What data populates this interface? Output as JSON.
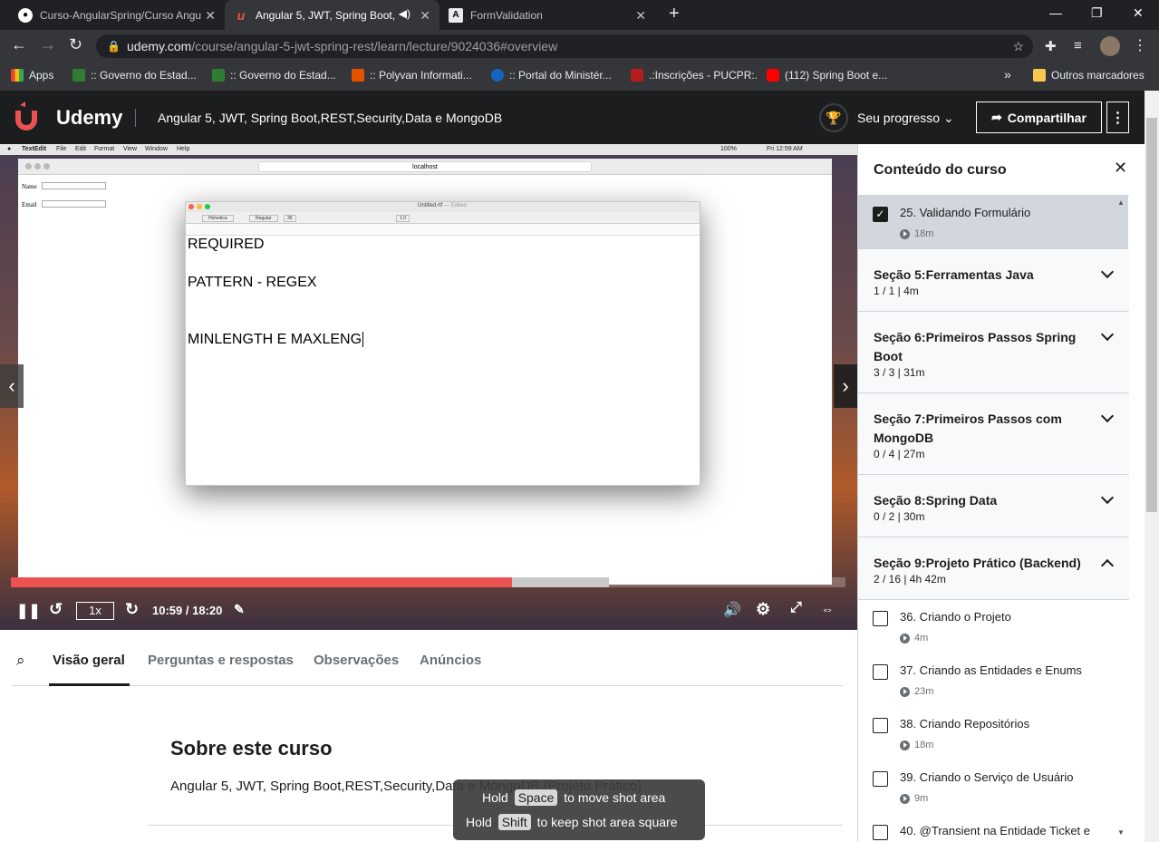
{
  "browser": {
    "tabs": [
      {
        "label": "Curso-AngularSpring/Curso Angu",
        "active": false
      },
      {
        "label": "Angular 5, JWT, Spring Boot,",
        "active": true
      },
      {
        "label": "FormValidation",
        "active": false
      }
    ],
    "new_tab": "+",
    "url_host": "udemy.com",
    "url_path": "/course/angular-5-jwt-spring-rest/learn/lecture/9024036#overview",
    "bookmarks": [
      "Apps",
      ":: Governo do Estad...",
      ":: Governo do Estad...",
      ":: Polyvan Informati...",
      ":: Portal do Ministér...",
      ".:Inscrições - PUCPR:.",
      "(112) Spring Boot e..."
    ],
    "bookmarks_more": "»",
    "other_bookmarks": "Outros marcadores"
  },
  "header": {
    "logo": "Udemy",
    "course_title": "Angular 5, JWT, Spring Boot,REST,Security,Data e MongoDB",
    "progress_label": "Seu progresso",
    "share_label": "Compartilhar"
  },
  "video": {
    "mac_menu": [
      "TextEdit",
      "File",
      "Edit",
      "Format",
      "View",
      "Window",
      "Help"
    ],
    "mac_clock": "Fri 12:59 AM",
    "mac_battery": "100%",
    "safari_url": "localhost",
    "form_name_label": "Name",
    "form_email_label": "Email",
    "textedit_title": "Untitled.rtf",
    "textedit_status": "— Edited",
    "textedit_font": "Helvetica",
    "textedit_style": "Regular",
    "textedit_size": "36",
    "textedit_spacing": "1.0",
    "doc_lines": [
      "REQUIRED",
      "PATTERN - REGEX",
      "MINLENGTH E MAXLENG"
    ],
    "speed": "1x",
    "time": "10:59 / 18:20",
    "progress": 0.6,
    "buffered": 0.717
  },
  "content_tabs": [
    "Visão geral",
    "Perguntas e respostas",
    "Observações",
    "Anúncios"
  ],
  "about": {
    "heading": "Sobre este curso",
    "subtitle": "Angular 5, JWT, Spring Boot,REST,Security,Data e MongoDB (Projeto Prático)"
  },
  "sidebar": {
    "title": "Conteúdo do curso",
    "current_lesson": {
      "title": "25. Validando Formulário",
      "duration": "18m",
      "checked": true
    },
    "sections": [
      {
        "title": "Seção 5:Ferramentas Java",
        "meta": "1 / 1 | 4m",
        "expanded": false
      },
      {
        "title": "Seção 6:Primeiros Passos Spring Boot",
        "meta": "3 / 3 | 31m",
        "expanded": false
      },
      {
        "title": "Seção 7:Primeiros Passos com MongoDB",
        "meta": "0 / 4 | 27m",
        "expanded": false
      },
      {
        "title": "Seção 8:Spring Data",
        "meta": "0 / 2 | 30m",
        "expanded": false
      },
      {
        "title": "Seção 9:Projeto Prático (Backend)",
        "meta": "2 / 16 | 4h 42m",
        "expanded": true
      }
    ],
    "lessons": [
      {
        "title": "36. Criando o Projeto",
        "duration": "4m"
      },
      {
        "title": "37. Criando as Entidades e Enums",
        "duration": "23m"
      },
      {
        "title": "38. Criando Repositórios",
        "duration": "18m"
      },
      {
        "title": "39. Criando o Serviço de Usuário",
        "duration": "9m"
      },
      {
        "title": "40. @Transient na Entidade Ticket e",
        "duration": ""
      }
    ]
  },
  "tooltip": {
    "line1_pre": "Hold",
    "line1_key": "Space",
    "line1_post": "to move shot area",
    "line2_pre": "Hold",
    "line2_key": "Shift",
    "line2_post": "to keep shot area square"
  },
  "colors": {
    "udemy_red": "#ec5252",
    "header_bg": "#1c1d1f",
    "accent_purple": "#5624d0"
  }
}
